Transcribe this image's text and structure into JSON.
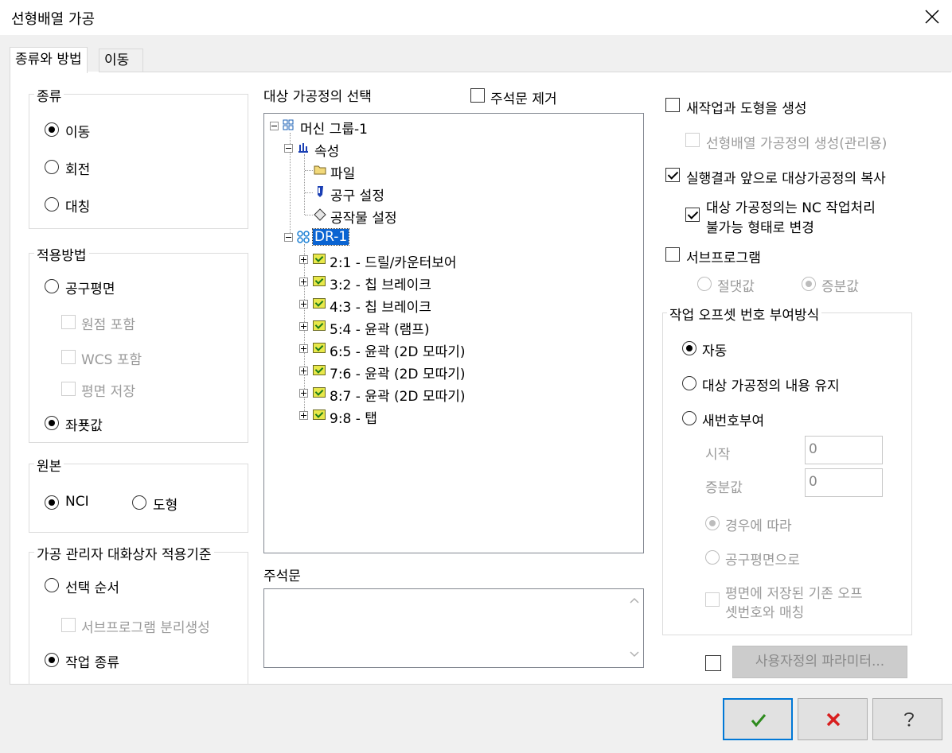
{
  "window": {
    "title": "선형배열 가공"
  },
  "tabs": [
    {
      "label": "종류와 방법"
    },
    {
      "label": "이동"
    }
  ],
  "type_group": {
    "label": "종류",
    "options": [
      "이동",
      "회전",
      "대칭"
    ],
    "selected": "이동"
  },
  "method_group": {
    "label": "적용방법",
    "tool_plane": "공구평면",
    "origin": "원점 포함",
    "wcs": "WCS 포함",
    "save_plane": "평면 저장",
    "coords": "좌푯값",
    "selected": "좌푯값"
  },
  "source_group": {
    "label": "원본",
    "nci": "NCI",
    "geometry": "도형",
    "selected": "NCI"
  },
  "manager_group": {
    "label": "가공 관리자 대화상자 적용기준",
    "select_order": "선택 순서",
    "subprog_split": "서브프로그램 분리생성",
    "op_type": "작업 종류",
    "selected": "작업 종류"
  },
  "target": {
    "label": "대상 가공정의 선택",
    "remove_comment": "주석문 제거",
    "tree": {
      "machine_group": "머신 그룹-1",
      "properties": "속성",
      "files": "파일",
      "tool_settings": "공구 설정",
      "stock_setup": "공작물 설정",
      "toolpath_group": "DR-1",
      "operations": [
        "2:1 - 드릴/카운터보어",
        "3:2 - 칩 브레이크",
        "4:3 - 칩 브레이크",
        "5:4 - 윤곽 (램프)",
        "6:5 - 윤곽 (2D 모따기)",
        "7:6 - 윤곽 (2D 모따기)",
        "8:7 - 윤곽 (2D 모따기)",
        "9:8 - 탭"
      ]
    }
  },
  "comment": {
    "label": "주석문"
  },
  "right": {
    "new_op_geo": "새작업과 도형을 생성",
    "create_manager_op": "선형배열 가공정의 생성(관리용)",
    "copy_source": "실행결과 앞으로 대상가공정의 복사",
    "disable_source_line1": "대상 가공정의는 NC 작업처리",
    "disable_source_line2": "불가능 형태로 변경",
    "subprogram": "서브프로그램",
    "absolute": "절댓값",
    "incremental": "증분값"
  },
  "offset_group": {
    "label": "작업 오프셋 번호 부여방식",
    "auto": "자동",
    "keep": "대상 가공정의 내용 유지",
    "renumber": "새번호부여",
    "start_label": "시작",
    "start_value": "0",
    "increment_label": "증분값",
    "increment_value": "0",
    "per_case": "경우에 따라",
    "by_tool_plane": "공구평면으로",
    "match_line1": "평면에 저장된 기존 오프",
    "match_line2": "셋번호와 매칭",
    "selected": "자동"
  },
  "custom_params": "사용자정의 파라미터...",
  "buttons": {
    "ok": "ok-icon",
    "cancel": "cancel-icon",
    "help": "help-icon"
  },
  "colors": {
    "ok": "#2e8b1e",
    "cancel": "#d81e1e",
    "accent": "#0078d7",
    "selection": "#0a64d2"
  }
}
